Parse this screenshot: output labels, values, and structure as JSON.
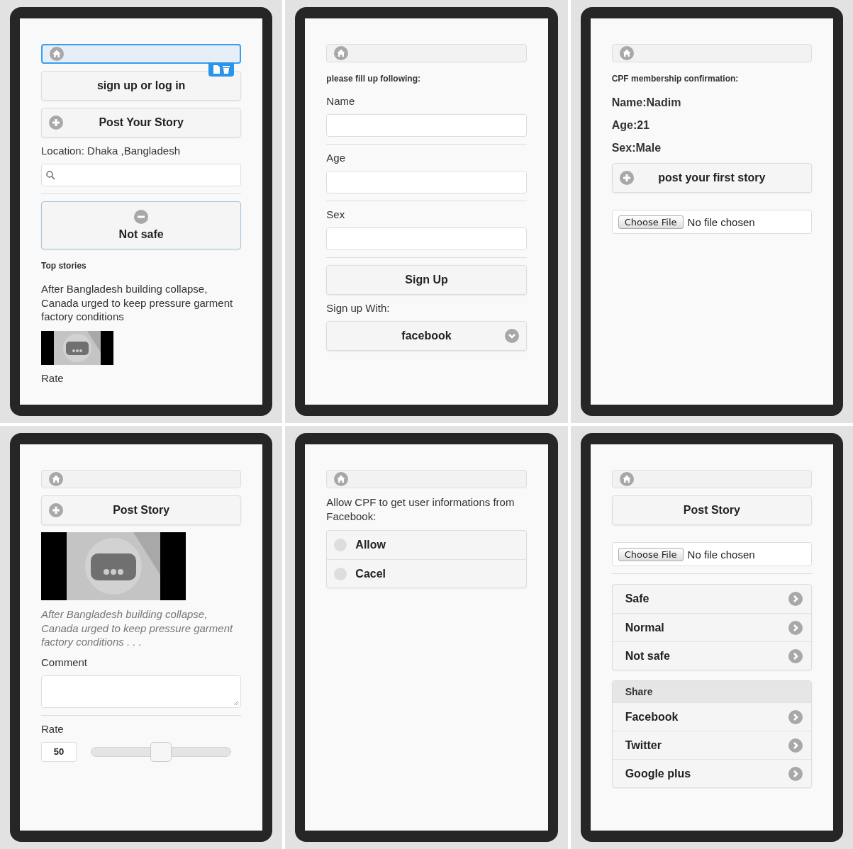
{
  "screens": [
    {
      "blocks": [
        {
          "kind": "home_bar",
          "selected": true
        },
        {
          "kind": "button",
          "label": "sign up or log in"
        },
        {
          "kind": "add_button",
          "label": "Post Your Story"
        },
        {
          "kind": "label",
          "text": "Location: Dhaka ,Bangladesh"
        },
        {
          "kind": "search"
        },
        {
          "kind": "divider"
        },
        {
          "kind": "status_button",
          "label": "Not safe"
        },
        {
          "kind": "heading",
          "text": "Top stories"
        },
        {
          "kind": "text",
          "text": "After Bangladesh building collapse, Canada urged to keep pressure garment factory conditions"
        },
        {
          "kind": "thumbnail"
        },
        {
          "kind": "label",
          "text": "Rate"
        }
      ]
    },
    {
      "blocks": [
        {
          "kind": "home_bar",
          "selected": false
        },
        {
          "kind": "heading",
          "text": "please fill up following:"
        },
        {
          "kind": "label",
          "text": "Name"
        },
        {
          "kind": "input"
        },
        {
          "kind": "divider"
        },
        {
          "kind": "label",
          "text": "Age"
        },
        {
          "kind": "input"
        },
        {
          "kind": "divider"
        },
        {
          "kind": "label",
          "text": "Sex"
        },
        {
          "kind": "input"
        },
        {
          "kind": "divider"
        },
        {
          "kind": "button",
          "label": "Sign Up"
        },
        {
          "kind": "label",
          "text": "Sign up With:"
        },
        {
          "kind": "select",
          "value": "facebook"
        }
      ]
    },
    {
      "blocks": [
        {
          "kind": "home_bar",
          "selected": false
        },
        {
          "kind": "heading",
          "text": "CPF membership confirmation:"
        },
        {
          "kind": "info",
          "text": "Name:Nadim"
        },
        {
          "kind": "info",
          "text": "Age:21"
        },
        {
          "kind": "info",
          "text": "Sex:Male"
        },
        {
          "kind": "add_button",
          "label": "post your first story"
        },
        {
          "kind": "file",
          "button": "Choose File",
          "status": "No file chosen"
        }
      ]
    },
    {
      "blocks": [
        {
          "kind": "home_bar",
          "selected": false
        },
        {
          "kind": "add_button",
          "label": "Post Story"
        },
        {
          "kind": "picture"
        },
        {
          "kind": "caption",
          "text": "After Bangladesh building collapse, Canada urged to keep pressure garment factory conditions . . ."
        },
        {
          "kind": "label",
          "text": "Comment"
        },
        {
          "kind": "textarea"
        },
        {
          "kind": "divider"
        },
        {
          "kind": "label",
          "text": "Rate"
        },
        {
          "kind": "slider",
          "value": "50",
          "level": 0.5
        }
      ]
    },
    {
      "blocks": [
        {
          "kind": "home_bar",
          "selected": false
        },
        {
          "kind": "text",
          "text": "Allow CPF to get user informations from Facebook:"
        },
        {
          "kind": "radio_group",
          "options": [
            {
              "label": "Allow",
              "selected": false
            },
            {
              "label": "Cacel",
              "selected": false
            }
          ]
        }
      ]
    },
    {
      "blocks": [
        {
          "kind": "home_bar",
          "selected": false
        },
        {
          "kind": "button",
          "label": "Post Story"
        },
        {
          "kind": "file",
          "button": "Choose File",
          "status": "No file chosen"
        },
        {
          "kind": "divider"
        },
        {
          "kind": "list",
          "items": [
            {
              "label": "Safe"
            },
            {
              "label": "Normal"
            },
            {
              "label": "Not safe"
            }
          ]
        },
        {
          "kind": "list",
          "header": "Share",
          "items": [
            {
              "label": "Facebook"
            },
            {
              "label": "Twitter"
            },
            {
              "label": "Google plus"
            }
          ]
        }
      ]
    }
  ]
}
